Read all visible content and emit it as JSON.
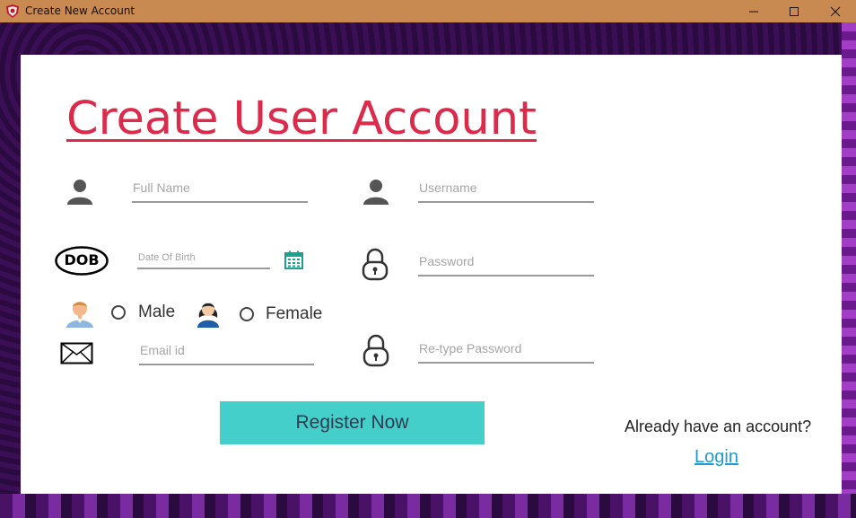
{
  "window": {
    "title": "Create New Account",
    "icon": "shield-app-icon",
    "controls": [
      "minimize",
      "maximize",
      "close"
    ]
  },
  "form": {
    "heading": "Create User Account",
    "full_name": {
      "placeholder": "Full Name",
      "value": "",
      "icon": "user-icon"
    },
    "username": {
      "placeholder": "Username",
      "value": "",
      "icon": "user-icon"
    },
    "dob": {
      "placeholder": "Date Of Birth",
      "value": "",
      "icon_label": "DOB",
      "picker_icon": "calendar-icon"
    },
    "password": {
      "placeholder": "Password",
      "value": "",
      "icon": "lock-icon"
    },
    "gender": {
      "options": [
        {
          "label": "Male",
          "icon": "male-avatar-icon",
          "selected": false
        },
        {
          "label": "Female",
          "icon": "female-avatar-icon",
          "selected": false
        }
      ]
    },
    "email": {
      "placeholder": "Email id",
      "value": "",
      "icon": "envelope-icon"
    },
    "retype_password": {
      "placeholder": "Re-type Password",
      "value": "",
      "icon": "lock-icon"
    },
    "register_label": "Register Now",
    "already_text": "Already have an account?",
    "login_label": "Login "
  },
  "colors": {
    "titlebar": "#c98a52",
    "heading": "#dc2a4b",
    "register_button": "#45cfcb",
    "link": "#1f9bd1",
    "calendar": "#1aa18f"
  }
}
